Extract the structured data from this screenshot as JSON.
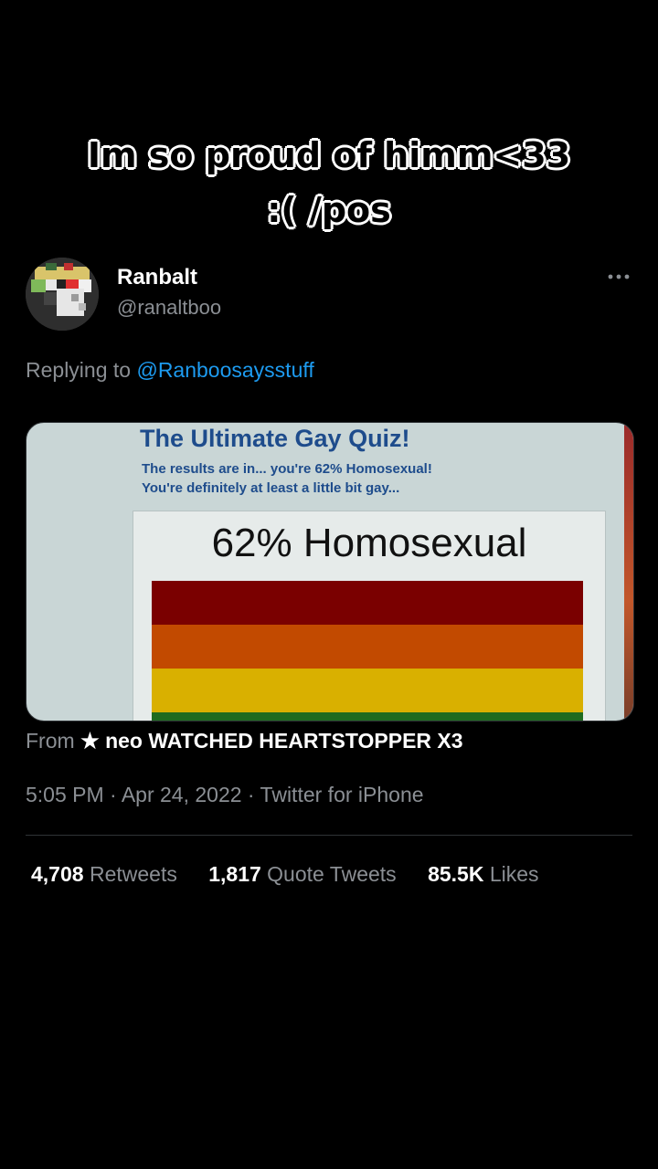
{
  "caption": {
    "line1": "Im so proud of himm<33",
    "line2": ":( /pos"
  },
  "tweet": {
    "display_name": "Ranbalt",
    "handle": "@ranaltboo",
    "more_icon": "more-horizontal-icon",
    "reply_prefix": "Replying to",
    "reply_mention": "@Ranboosaysstuff",
    "media": {
      "quiz_title": "The Ultimate Gay Quiz!",
      "quiz_line1": "The results are in... you're 62% Homosexual!",
      "quiz_line2": "You're definitely at least a little bit gay...",
      "result": "62% Homosexual",
      "flag_colors": [
        "#7a0000",
        "#c24a00",
        "#d9b000",
        "#1f6b1f"
      ]
    },
    "from_prefix": "From",
    "from_name": "★ neo WATCHED HEARTSTOPPER X3",
    "timestamp": "5:05 PM · Apr 24, 2022 · Twitter for iPhone",
    "stats": {
      "retweets_count": "4,708",
      "retweets_label": "Retweets",
      "quotes_count": "1,817",
      "quotes_label": "Quote Tweets",
      "likes_count": "85.5K",
      "likes_label": "Likes"
    }
  },
  "colors": {
    "background": "#000000",
    "secondary_text": "#8b8f94",
    "link": "#1d9bf0"
  }
}
